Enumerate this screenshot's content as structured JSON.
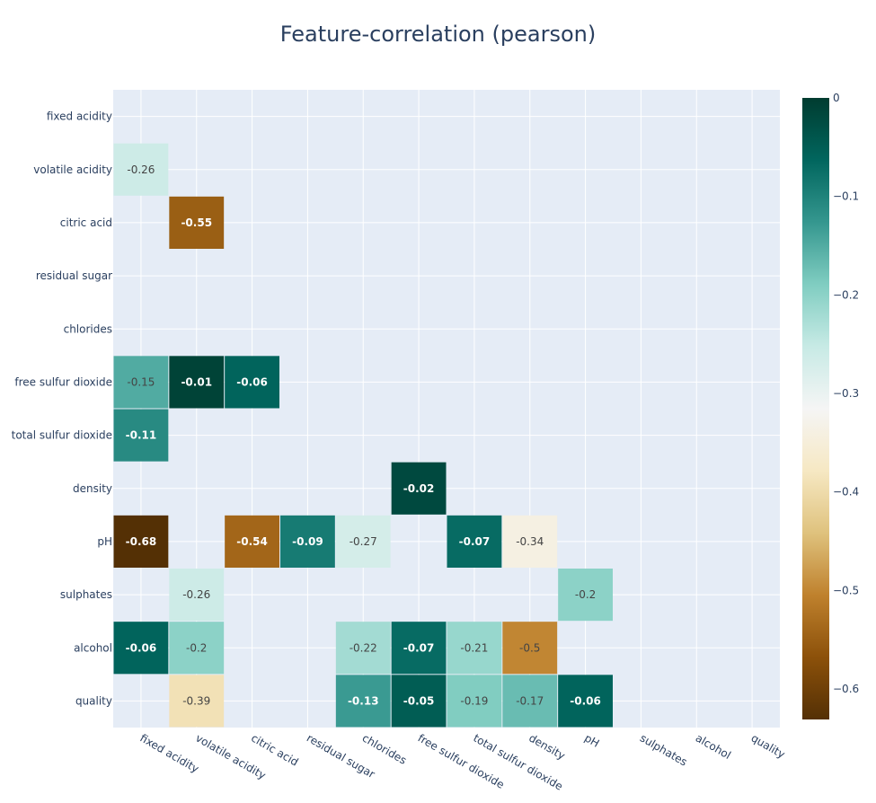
{
  "chart_data": {
    "type": "heatmap",
    "title": "Feature-correlation (pearson)",
    "xlabel": "",
    "ylabel": "",
    "x_categories": [
      "fixed acidity",
      "volatile acidity",
      "citric acid",
      "residual sugar",
      "chlorides",
      "free sulfur dioxide",
      "total sulfur dioxide",
      "density",
      "pH",
      "sulphates",
      "alcohol",
      "quality"
    ],
    "y_categories": [
      "fixed acidity",
      "volatile acidity",
      "citric acid",
      "residual sugar",
      "chlorides",
      "free sulfur dioxide",
      "total sulfur dioxide",
      "density",
      "pH",
      "sulphates",
      "alcohol",
      "quality"
    ],
    "z": [
      [
        null,
        null,
        null,
        null,
        null,
        null,
        null,
        null,
        null,
        null,
        null,
        null
      ],
      [
        -0.26,
        null,
        null,
        null,
        null,
        null,
        null,
        null,
        null,
        null,
        null,
        null
      ],
      [
        null,
        -0.55,
        null,
        null,
        null,
        null,
        null,
        null,
        null,
        null,
        null,
        null
      ],
      [
        null,
        null,
        null,
        null,
        null,
        null,
        null,
        null,
        null,
        null,
        null,
        null
      ],
      [
        null,
        null,
        null,
        null,
        null,
        null,
        null,
        null,
        null,
        null,
        null,
        null
      ],
      [
        -0.15,
        -0.01,
        -0.06,
        null,
        null,
        null,
        null,
        null,
        null,
        null,
        null,
        null
      ],
      [
        -0.11,
        null,
        null,
        null,
        null,
        null,
        null,
        null,
        null,
        null,
        null,
        null
      ],
      [
        null,
        null,
        null,
        null,
        null,
        -0.02,
        null,
        null,
        null,
        null,
        null,
        null
      ],
      [
        -0.68,
        null,
        -0.54,
        -0.09,
        -0.27,
        null,
        -0.07,
        -0.34,
        null,
        null,
        null,
        null
      ],
      [
        null,
        -0.26,
        null,
        null,
        null,
        null,
        null,
        null,
        -0.2,
        null,
        null,
        null
      ],
      [
        -0.06,
        -0.2,
        null,
        null,
        -0.22,
        -0.07,
        -0.21,
        -0.5,
        null,
        null,
        null,
        null
      ],
      [
        null,
        -0.39,
        null,
        null,
        -0.13,
        -0.05,
        -0.19,
        -0.17,
        -0.06,
        null,
        null,
        null
      ]
    ],
    "text": [
      [
        "",
        "",
        "",
        "",
        "",
        "",
        "",
        "",
        "",
        "",
        "",
        ""
      ],
      [
        "-0.26",
        "",
        "",
        "",
        "",
        "",
        "",
        "",
        "",
        "",
        "",
        ""
      ],
      [
        "",
        "-0.55",
        "",
        "",
        "",
        "",
        "",
        "",
        "",
        "",
        "",
        ""
      ],
      [
        "",
        "",
        "",
        "",
        "",
        "",
        "",
        "",
        "",
        "",
        "",
        ""
      ],
      [
        "",
        "",
        "",
        "",
        "",
        "",
        "",
        "",
        "",
        "",
        "",
        ""
      ],
      [
        "-0.15",
        "-0.01",
        "-0.06",
        "",
        "",
        "",
        "",
        "",
        "",
        "",
        "",
        ""
      ],
      [
        "-0.11",
        "",
        "",
        "",
        "",
        "",
        "",
        "",
        "",
        "",
        "",
        ""
      ],
      [
        "",
        "",
        "",
        "",
        "",
        "-0.02",
        "",
        "",
        "",
        "",
        "",
        ""
      ],
      [
        "-0.68",
        "",
        "-0.54",
        "-0.09",
        "-0.27",
        "",
        "-0.07",
        "-0.34",
        "",
        "",
        "",
        ""
      ],
      [
        "",
        "-0.26",
        "",
        "",
        "",
        "",
        "",
        "",
        "-0.2",
        "",
        "",
        ""
      ],
      [
        "-0.06",
        "-0.2",
        "",
        "",
        "-0.22",
        "-0.07",
        "-0.21",
        "-0.5",
        "",
        "",
        "",
        ""
      ],
      [
        "",
        "-0.39",
        "",
        "",
        "-0.13",
        "-0.05",
        "-0.19",
        "-0.17",
        "-0.06",
        "",
        "",
        ""
      ]
    ],
    "zrange": [
      -0.631,
      0
    ],
    "colorscale": "BrBG",
    "colorscale_stops": [
      [
        0.0,
        "#543005"
      ],
      [
        0.1,
        "#8c510a"
      ],
      [
        0.2,
        "#bf812d"
      ],
      [
        0.3,
        "#dfc27d"
      ],
      [
        0.4,
        "#f6e8c3"
      ],
      [
        0.5,
        "#f5f5f5"
      ],
      [
        0.6,
        "#c7eae5"
      ],
      [
        0.7,
        "#80cdc1"
      ],
      [
        0.8,
        "#35978f"
      ],
      [
        0.9,
        "#01665e"
      ],
      [
        1.0,
        "#003c30"
      ]
    ],
    "colorbar": {
      "ticks": [
        0,
        -0.1,
        -0.2,
        -0.3,
        -0.4,
        -0.5,
        -0.6
      ],
      "tick_labels": [
        "0",
        "−0.1",
        "−0.2",
        "−0.3",
        "−0.4",
        "−0.5",
        "−0.6"
      ],
      "placement": "right"
    },
    "grid": true,
    "plot_background": "#e5ecf6",
    "legend": "none"
  }
}
